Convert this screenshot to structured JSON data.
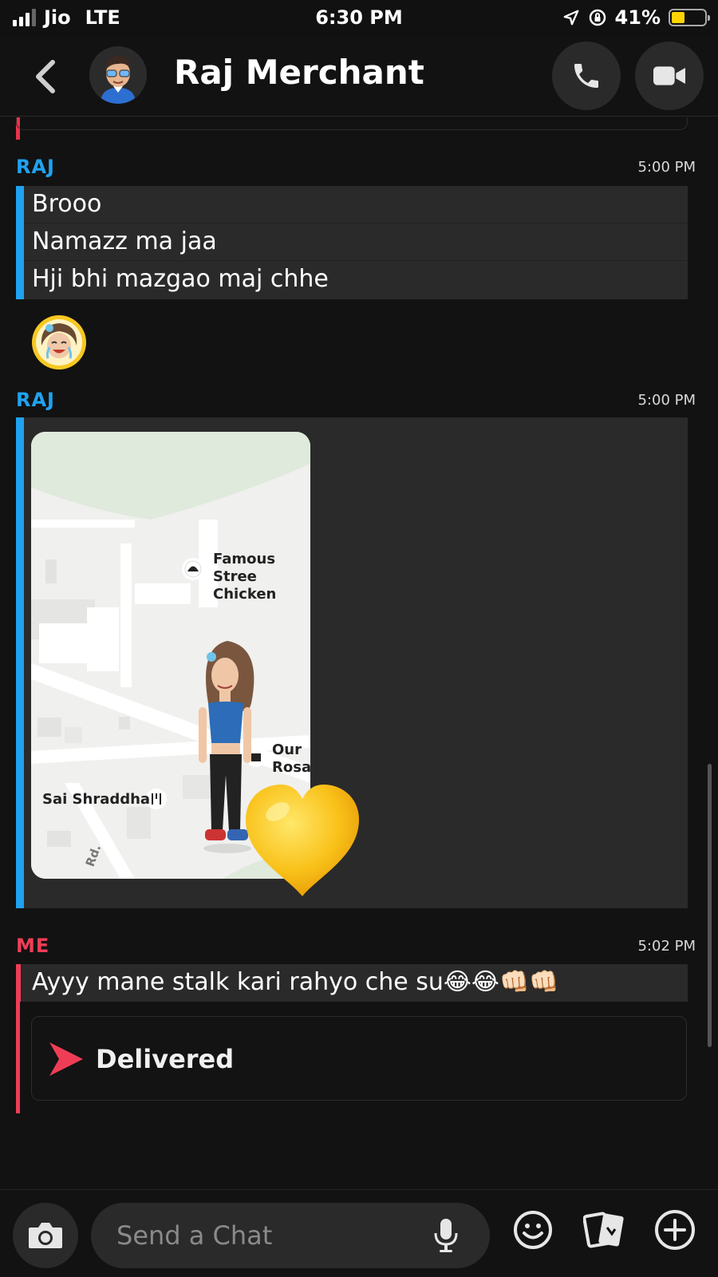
{
  "status_bar": {
    "carrier": "Jio",
    "network": "LTE",
    "time": "6:30 PM",
    "battery_percent": "41%",
    "battery_level": 0.41
  },
  "header": {
    "title": "Raj Merchant",
    "icons": {
      "back": "chevron-left-icon",
      "call": "phone-icon",
      "video": "video-camera-icon"
    }
  },
  "messages": [
    {
      "sender": "RAJ",
      "time": "5:00 PM",
      "lines": [
        "Brooo",
        "Namazz ma jaa",
        "Hji bhi mazgao maj chhe"
      ]
    },
    {
      "sender": "RAJ",
      "time": "5:00 PM",
      "map": {
        "labels": [
          "Famous Stree",
          "Chicken",
          "Our",
          "Rosa",
          "Sai Shraddha",
          "Rd."
        ]
      },
      "reaction": "yellow-heart"
    },
    {
      "sender": "ME",
      "time": "5:02 PM",
      "text": "Ayyy mane stalk kari rahyo che su😂😂👊🏻👊🏻",
      "status": "Delivered"
    }
  ],
  "composer": {
    "placeholder": "Send a Chat",
    "icons": [
      "camera-icon",
      "microphone-icon",
      "smiley-icon",
      "stickers-icon",
      "plus-icon"
    ]
  },
  "colors": {
    "raj": "#1fa2f0",
    "me": "#ef3d56",
    "bubble": "#2a2a2a",
    "background": "#121212"
  }
}
